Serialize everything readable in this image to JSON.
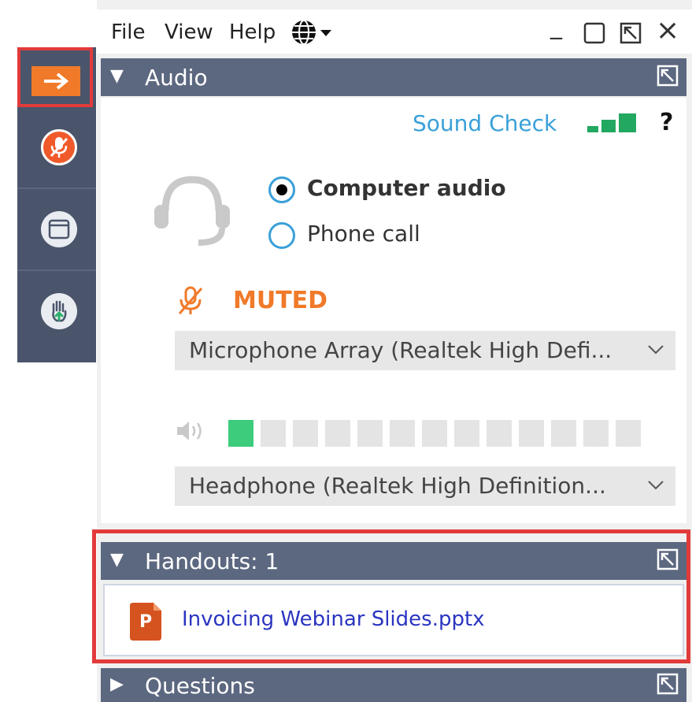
{
  "menu": {
    "file": "File",
    "view": "View",
    "help": "Help",
    "globe_icon": "globe-icon",
    "minimize": "_",
    "close": "×"
  },
  "audio": {
    "header": "Audio",
    "sound_check": "Sound Check",
    "help_symbol": "?",
    "options": [
      {
        "label": "Computer audio",
        "selected": true
      },
      {
        "label": "Phone call",
        "selected": false
      }
    ],
    "mic_status": "MUTED",
    "microphone": "Microphone Array (Realtek High Defi...",
    "speaker": "Headphone (Realtek High Definition...",
    "speaker_level_fraction": 0.077
  },
  "handouts": {
    "header": "Handouts: 1",
    "file_badge": "P",
    "file_name": "Invoicing Webinar Slides.pptx"
  },
  "questions": {
    "header": "Questions"
  },
  "colors": {
    "accent_orange": "#f07a2a",
    "header_bg": "#5c6880",
    "toolbar_bg": "#4a556b",
    "link_blue": "#3aa0d8",
    "level_green": "#3ccc7c",
    "highlight_red": "#e23a3a"
  }
}
